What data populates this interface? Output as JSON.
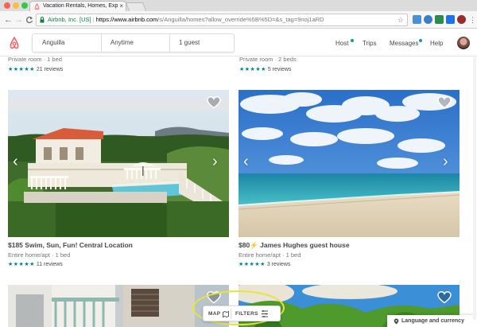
{
  "browser": {
    "tab_title": "Vacation Rentals, Homes, Exp",
    "tab_close": "×",
    "secure_label": "Airbnb, Inc. [US]",
    "url_host": "https://www.airbnb.com",
    "url_path": "/s/Anguilla/homes?allow_override%5B%5D=&s_tag=9noj1aRD",
    "back": "←",
    "forward": "→",
    "reload": "C",
    "bookmark_star": "☆",
    "colors": {
      "close": "#fc605c",
      "minimize": "#fdbc40",
      "maximize": "#34c84a"
    }
  },
  "header": {
    "search": {
      "location": "Anguilla",
      "dates": "Anytime",
      "guests": "1 guest"
    },
    "nav": {
      "host": "Host",
      "trips": "Trips",
      "messages": "Messages",
      "help": "Help"
    },
    "accent": "#ff5a5f",
    "notification_color": "#00a699"
  },
  "top_listings": [
    {
      "subtitle": "Private room · 1 bed",
      "stars": "★★★★★",
      "reviews": "21 reviews"
    },
    {
      "subtitle": "Private room · 2 beds",
      "stars": "★★★★★",
      "reviews": "5 reviews"
    }
  ],
  "listings": [
    {
      "price": "$185",
      "name": "Swim, Sun, Fun! Central Location",
      "subtitle": "Entire home/apt · 1 bed",
      "stars": "★★★★★",
      "reviews": "11 reviews",
      "icon": "villa-pool-photo"
    },
    {
      "price": "$80",
      "badge": "⚡",
      "name": "James Hughes guest house",
      "subtitle": "Entire home/apt · 1 bed",
      "stars": "★★★★★",
      "reviews": "3 reviews",
      "icon": "beach-photo"
    }
  ],
  "controls": {
    "map": "MAP",
    "filters": "FILTERS",
    "language": "Language and currency"
  },
  "carousel": {
    "prev": "‹",
    "next": "›"
  }
}
